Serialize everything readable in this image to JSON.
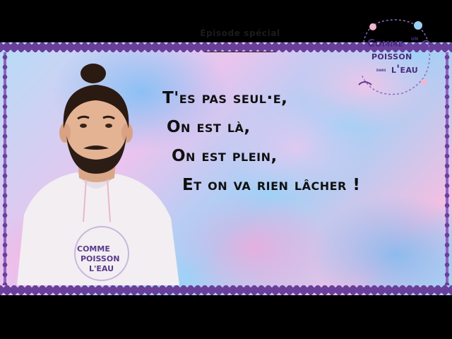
{
  "episode_label": "Épisode spécial",
  "quote_lines": [
    "T'es pas seul·e,",
    "On est là,",
    "On est plein,",
    "Et on va rien lâcher !"
  ],
  "logo": {
    "line1": "Comme",
    "un": "un",
    "line2": "poisson",
    "dans": "dans",
    "line3": "l'eau"
  },
  "colors": {
    "border": "#6a3f9b",
    "logo_text": "#4a2a7d",
    "text": "#101010"
  }
}
